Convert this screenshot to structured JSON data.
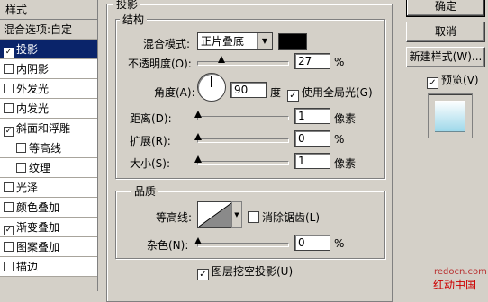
{
  "styles": {
    "title": "样式",
    "items": [
      {
        "label": "混合选项:自定",
        "checked": null
      },
      {
        "label": "投影",
        "checked": true,
        "selected": true
      },
      {
        "label": "内阴影",
        "checked": false
      },
      {
        "label": "外发光",
        "checked": false
      },
      {
        "label": "内发光",
        "checked": false
      },
      {
        "label": "斜面和浮雕",
        "checked": true
      },
      {
        "label": "等高线",
        "checked": false,
        "sub": true
      },
      {
        "label": "纹理",
        "checked": false,
        "sub": true
      },
      {
        "label": "光泽",
        "checked": false
      },
      {
        "label": "颜色叠加",
        "checked": false
      },
      {
        "label": "渐变叠加",
        "checked": true
      },
      {
        "label": "图案叠加",
        "checked": false
      },
      {
        "label": "描边",
        "checked": false
      }
    ]
  },
  "panel": {
    "title": "投影",
    "structure": {
      "title": "结构",
      "blend_mode_label": "混合模式:",
      "blend_mode_value": "正片叠底",
      "color": "#000000",
      "opacity_label": "不透明度(O):",
      "opacity_value": "27",
      "opacity_unit": "%",
      "opacity_level": 0.27,
      "angle_label": "角度(A):",
      "angle_value": "90",
      "angle_unit": "度",
      "use_global_light": "使用全局光(G)",
      "distance_label": "距离(D):",
      "distance_value": "1",
      "distance_unit": "像素",
      "spread_label": "扩展(R):",
      "spread_value": "0",
      "spread_unit": "%",
      "size_label": "大小(S):",
      "size_value": "1",
      "size_unit": "像素"
    },
    "quality": {
      "title": "品质",
      "contour_label": "等高线:",
      "anti_alias": "消除锯齿(L)",
      "noise_label": "杂色(N):",
      "noise_value": "0",
      "noise_unit": "%"
    },
    "knockout": "图层挖空投影(U)"
  },
  "buttons": {
    "ok": "确定",
    "cancel": "取消",
    "new_style": "新建样式(W)...",
    "preview": "预览(V)"
  },
  "watermark": {
    "url": "redocn.com",
    "text": "红动中国"
  }
}
